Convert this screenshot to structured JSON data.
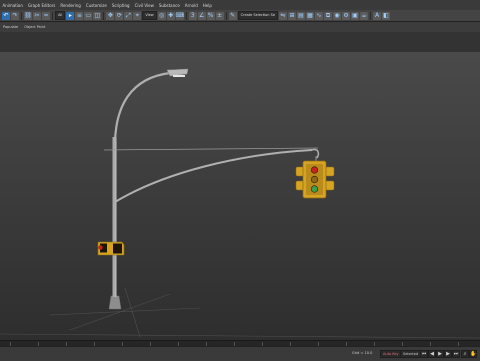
{
  "menubar": {
    "items": [
      "Animation",
      "Graph Editors",
      "Rendering",
      "Customize",
      "Scripting",
      "Civil View",
      "Substance",
      "Arnold",
      "Help"
    ]
  },
  "toolbar": {
    "all_filter": "All",
    "selection_set": "Create Selection Se",
    "view_dropdown": "View"
  },
  "ribbon": {
    "tabs": [
      "Populate",
      "Object Paint"
    ]
  },
  "statusbar": {
    "grid_label": "Grid = 10.0",
    "auto_key": "Auto Key",
    "selected": "Selected",
    "set_key": "Set Key",
    "key_filters": "Key Filters..."
  },
  "colors": {
    "signal_yellow": "#d6a422",
    "pole_gray": "#a9a9a9",
    "red_light": "#c0261c",
    "amber_light": "#8a6a14",
    "green_light": "#3aa04a",
    "accent_blue": "#2f6fae"
  }
}
